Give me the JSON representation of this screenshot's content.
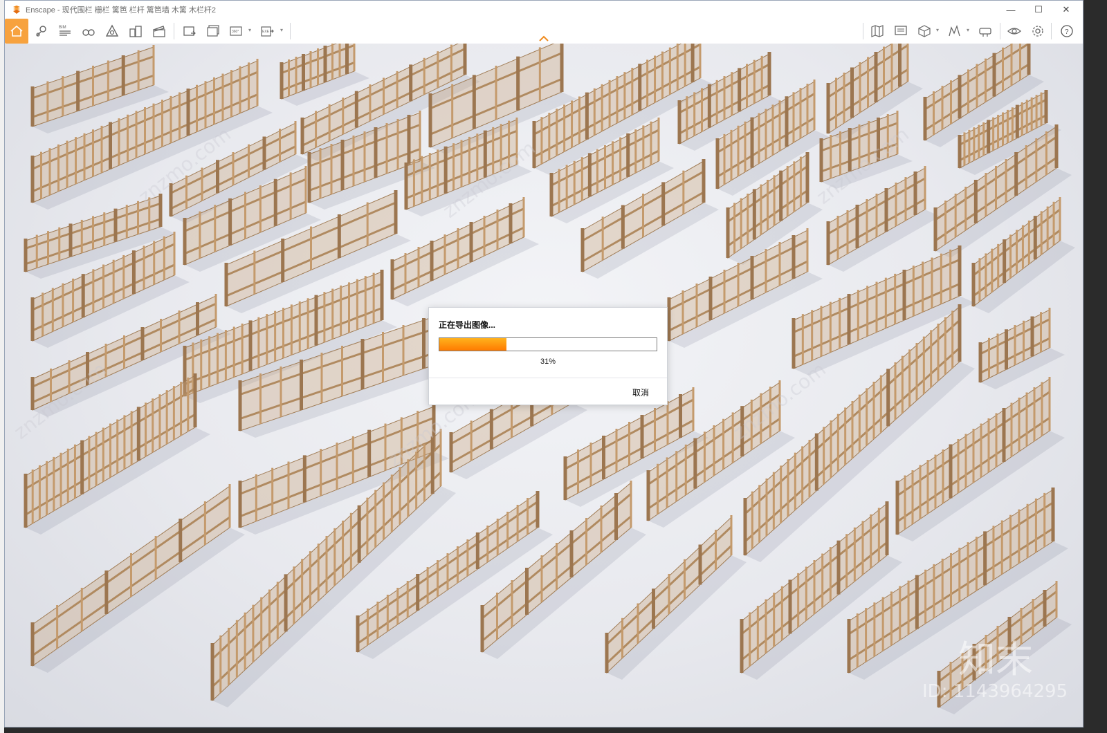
{
  "window": {
    "title": "Enscape - 现代围栏 栅栏 篱笆 栏杆 篱笆墙 木篱 木栏杆2",
    "controls": {
      "minimize": "—",
      "maximize": "☐",
      "close": "✕"
    }
  },
  "toolbar": {
    "left_icons": [
      "home-icon",
      "asset-library-icon",
      "bim-icon",
      "binoculars-icon",
      "atmosphere-icon",
      "buildings-icon",
      "clapper-icon",
      "screenshot-icon",
      "batch-render-icon",
      "panorama-360-icon",
      "export-exe-icon"
    ],
    "bim_label": "BIM",
    "pano_label": "360°",
    "exe_label": "EXE",
    "right_icons": [
      "map-icon",
      "monitor-icon",
      "cube-icon",
      "chart-icon",
      "vr-headset-icon",
      "eye-icon",
      "gear-icon",
      "help-icon"
    ]
  },
  "dialog": {
    "title": "正在导出图像...",
    "progress_label": "31%",
    "progress_value": 0.31,
    "cancel_label": "取消"
  },
  "watermark": {
    "logo": "知末",
    "id_text": "ID: 1143964295"
  },
  "colors": {
    "accent": "#f7a23e",
    "progress": "#ff8c00",
    "wood": "#c9a47a"
  }
}
